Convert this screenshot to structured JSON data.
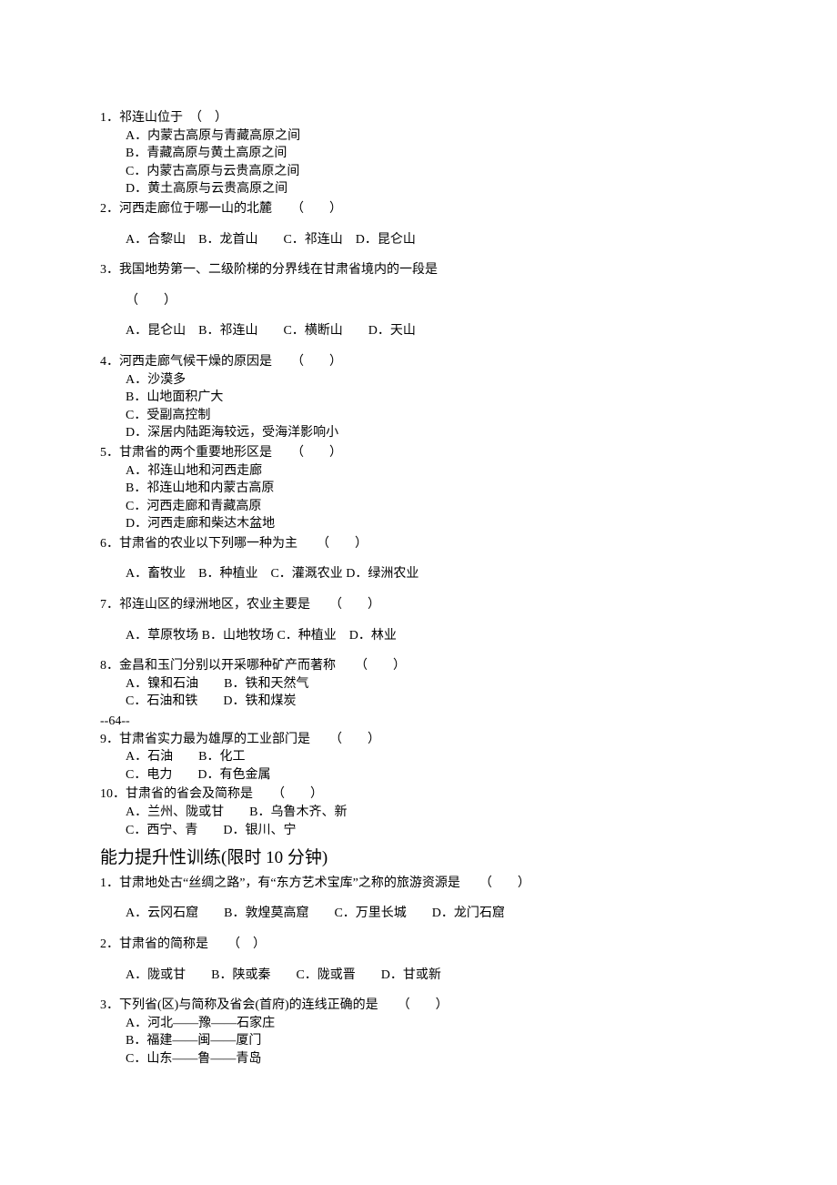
{
  "section1": {
    "q1": {
      "stem": "1．祁连山位于　（　）",
      "A": "A．内蒙古高原与青藏高原之间",
      "B": "B．青藏高原与黄土高原之间",
      "C": "C．内蒙古高原与云贵高原之间",
      "D": "D．黄土高原与云贵高原之间"
    },
    "q2": {
      "stem": "2．河西走廊位于哪一山的北麓　　（　　）",
      "options": "A．合黎山　B．龙首山　　C．祁连山　D．昆仑山"
    },
    "q3": {
      "stem": "3．我国地势第一、二级阶梯的分界线在甘肃省境内的一段是",
      "blank": "（　　）",
      "options": "A．昆仑山　B．祁连山　　C．横断山　　D．天山"
    },
    "q4": {
      "stem": "4．河西走廊气候干燥的原因是　　（　　）",
      "A": "A．沙漠多",
      "B": "B．山地面积广大",
      "C": "C．受副高控制",
      "D": "D．深居内陆距海较远，受海洋影响小"
    },
    "q5": {
      "stem": "5．甘肃省的两个重要地形区是　　（　　）",
      "A": "A．祁连山地和河西走廊",
      "B": "B．祁连山地和内蒙古高原",
      "C": "C．河西走廊和青藏高原",
      "D": "D．河西走廊和柴达木盆地"
    },
    "q6": {
      "stem": "6．甘肃省的农业以下列哪一种为主　　（　　）",
      "options": "A．畜牧业　B．种植业　C．灌溉农业 D．绿洲农业"
    },
    "q7": {
      "stem": "7．祁连山区的绿洲地区，农业主要是　　（　　）",
      "options": "A．草原牧场 B．山地牧场 C．种植业　D．林业"
    },
    "q8": {
      "stem": "8．金昌和玉门分别以开采哪种矿产而著称　　（　　）",
      "row1": "A．镍和石油　　B．铁和天然气",
      "row2": "C．石油和铁　　D．铁和煤炭"
    },
    "pageMarker": "--64--",
    "q9": {
      "stem": "9．甘肃省实力最为雄厚的工业部门是　　（　　）",
      "row1": "A．石油　　B．化工",
      "row2": "C．电力　　D．有色金属"
    },
    "q10": {
      "stem": "10．甘肃省的省会及简称是　　（　　）",
      "row1": "A．兰州、陇或甘　　B．乌鲁木齐、新",
      "row2": "C．西宁、青　　D．银川、宁"
    }
  },
  "section2": {
    "title": "能力提升性训练(限时 10 分钟)",
    "q1": {
      "stem": "1．甘肃地处古“丝绸之路”，有“东方艺术宝库”之称的旅游资源是　　（　　）",
      "options": "A．云冈石窟　　B．敦煌莫高窟　　C．万里长城　　D．龙门石窟"
    },
    "q2": {
      "stem": "2．甘肃省的简称是　　（　）",
      "options": "A．陇或甘　　B．陕或秦　　C．陇或晋　　D．甘或新"
    },
    "q3": {
      "stem": "3．下列省(区)与简称及省会(首府)的连线正确的是　　（　　）",
      "A": "A．河北——豫——石家庄",
      "B": "B．福建——闽——厦门",
      "C": "C．山东——鲁——青岛"
    }
  }
}
